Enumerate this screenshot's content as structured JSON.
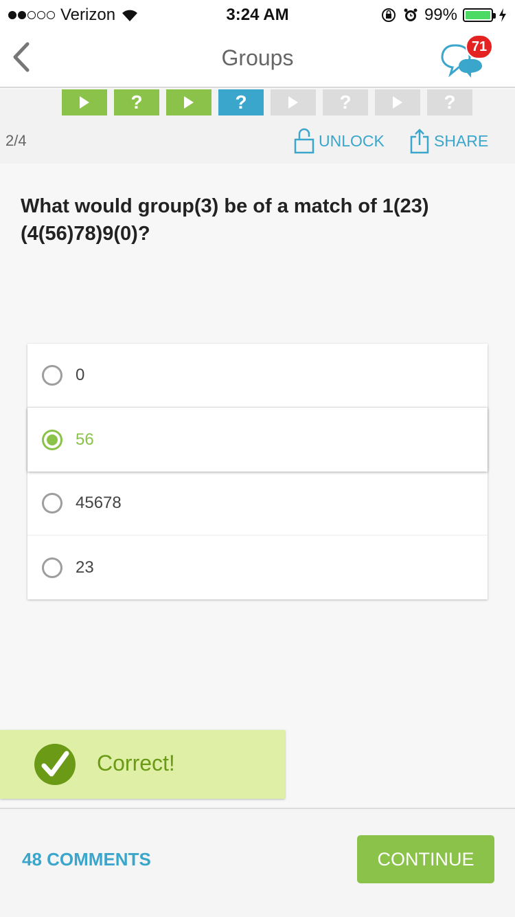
{
  "status_bar": {
    "carrier": "Verizon",
    "time": "3:24 AM",
    "battery_percent": "99%",
    "battery_level": 0.99,
    "signal_bars_filled": 2,
    "signal_bars_total": 5
  },
  "nav": {
    "title": "Groups",
    "chat_badge": "71",
    "back_icon": "chevron-left-icon",
    "chat_icon": "chat-bubbles-icon"
  },
  "progress": {
    "steps": [
      {
        "kind": "play",
        "state": "complete",
        "glyph": ""
      },
      {
        "kind": "quiz",
        "state": "complete",
        "glyph": "?"
      },
      {
        "kind": "play",
        "state": "complete",
        "glyph": ""
      },
      {
        "kind": "quiz",
        "state": "current",
        "glyph": "?"
      },
      {
        "kind": "play",
        "state": "locked",
        "glyph": ""
      },
      {
        "kind": "quiz",
        "state": "locked",
        "glyph": "?"
      },
      {
        "kind": "play",
        "state": "locked",
        "glyph": ""
      },
      {
        "kind": "quiz",
        "state": "locked",
        "glyph": "?"
      }
    ],
    "page_count": "2/4",
    "unlock_label": "UNLOCK",
    "share_label": "SHARE"
  },
  "question": {
    "text": "What would group(3) be of a match of 1(23)(4(56)78)9(0)?"
  },
  "options": [
    {
      "label": "0",
      "selected": false
    },
    {
      "label": "56",
      "selected": true
    },
    {
      "label": "45678",
      "selected": false
    },
    {
      "label": "23",
      "selected": false
    }
  ],
  "result": {
    "text": "Correct!",
    "icon": "check-icon"
  },
  "footer": {
    "comments_label": "48 COMMENTS",
    "continue_label": "CONTINUE"
  },
  "colors": {
    "green": "#8bc34a",
    "blue": "#3aa6cc",
    "grey_step": "#dcdcdc",
    "badge_red": "#e52222",
    "correct_bg": "#dff0a6",
    "correct_dark": "#6a9a16"
  }
}
